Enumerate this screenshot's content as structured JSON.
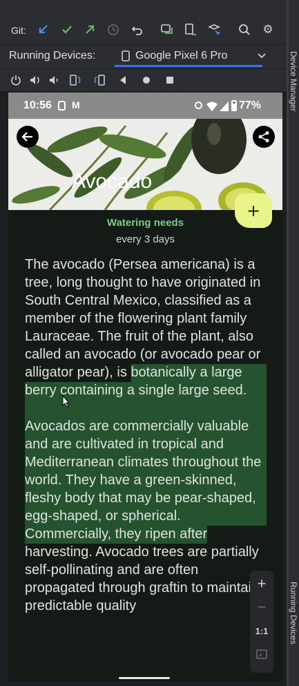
{
  "toolbar": {
    "git_label": "Git:",
    "icons": [
      "update-project-icon",
      "commit-check-icon",
      "push-arrow-icon",
      "history-clock-icon",
      "undo-icon",
      "sync-devices-icon",
      "device-install-icon",
      "stack-icon",
      "search-icon",
      "settings-gear-icon"
    ]
  },
  "running_devices": {
    "label": "Running Devices:",
    "tab_label": "Google Pixel 6 Pro",
    "controls": [
      "power-icon",
      "volume-up-icon",
      "volume-down-icon",
      "rotate-left-icon",
      "rotate-right-icon",
      "back-icon",
      "home-icon",
      "overview-icon"
    ]
  },
  "side_panel": {
    "top_label": "Device Manager",
    "bottom_label": "Running Devices"
  },
  "phone": {
    "status": {
      "time": "10:56",
      "battery": "77%"
    },
    "plant_name": "Avocado",
    "watering": {
      "title": "Watering needs",
      "value": "every 3 days"
    },
    "description": "The avocado (Persea americana) is a tree, long thought to have originated in South Central Mexico, classified as a member of the flowering plant family Lauraceae. The fruit of the plant, also called an avocado (or avocado pear or alligator pear), is botanically a large berry containing a single large seed.\n\nAvocados are commercially valuable and are cultivated in tropical and Mediterranean climates throughout the world. They have a green-skinned, fleshy body that may be pear-shaped, egg-shaped, or spherical. Commercially, they ripen after harvesting. Avocado trees are partially self-pollinating and are often propagated through graftin to maintain a predictable quality",
    "fab_label": "+"
  },
  "zoom_controls": {
    "zoom_in": "+",
    "zoom_out": "−",
    "actual_size": "1:1"
  },
  "colors": {
    "accent": "#3574f0",
    "fab": "#e9f58a",
    "watering_title": "#7ccb86",
    "selection": "#307840"
  }
}
